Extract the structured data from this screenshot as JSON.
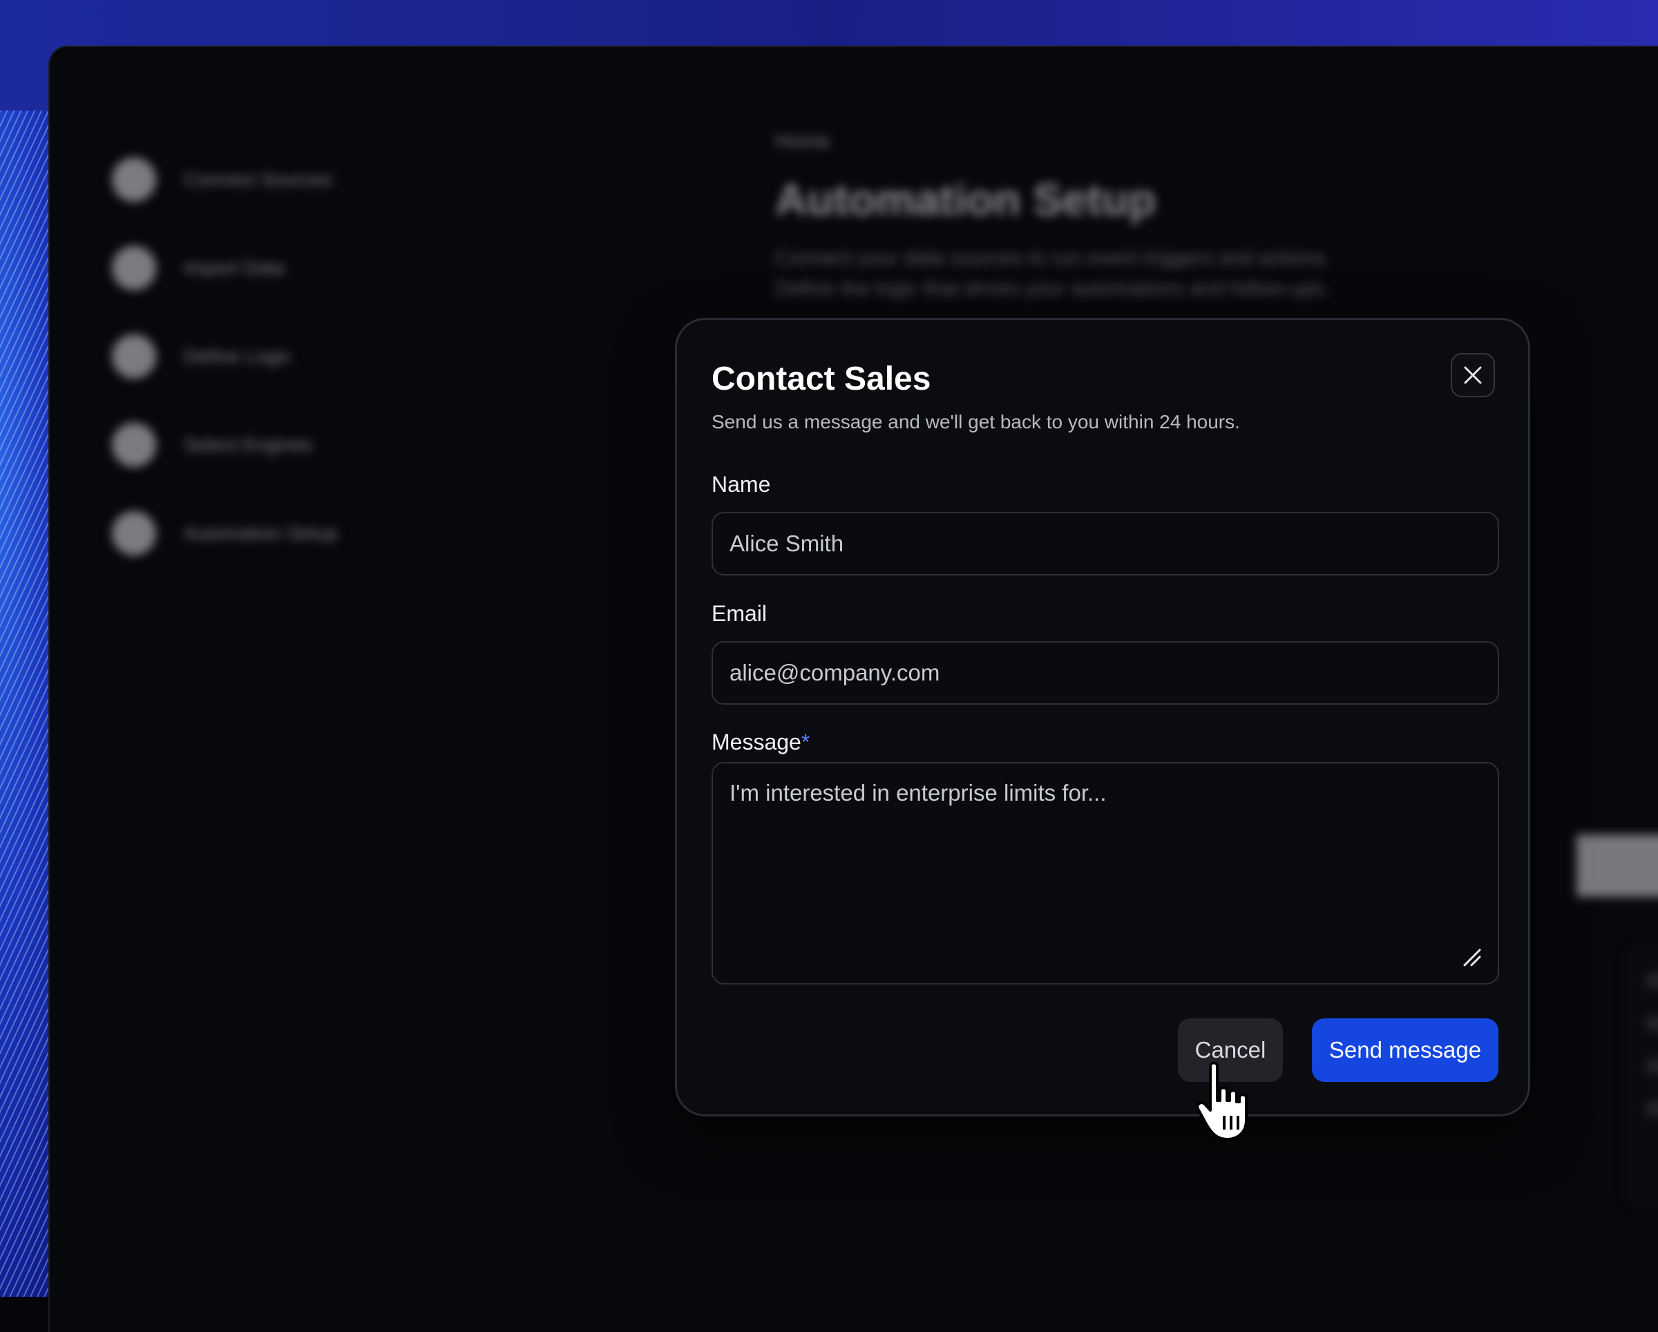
{
  "background": {
    "breadcrumb": "Home",
    "page_title": "Automation Setup",
    "page_description_line1": "Connect your data sources to run event triggers and actions.",
    "page_description_line2": "Define the logic that drives your automations and follow-ups.",
    "sidebar_items": [
      {
        "label": "Connect Sources"
      },
      {
        "label": "Import Data"
      },
      {
        "label": "Define Logic"
      },
      {
        "label": "Select Engines"
      },
      {
        "label": "Automation Setup"
      }
    ]
  },
  "modal": {
    "title": "Contact Sales",
    "subtitle": "Send us a message and we'll get back to you within 24 hours.",
    "close_icon": "close-icon",
    "fields": {
      "name": {
        "label": "Name",
        "value": "Alice Smith"
      },
      "email": {
        "label": "Email",
        "value": "alice@company.com"
      },
      "message": {
        "label": "Message",
        "required_marker": "*",
        "placeholder": "I'm interested in enterprise limits for..."
      }
    },
    "actions": {
      "cancel_label": "Cancel",
      "send_label": "Send message"
    }
  },
  "colors": {
    "accent": "#1546e0",
    "required": "#5b7cff",
    "modal_bg": "#0b0c10"
  }
}
